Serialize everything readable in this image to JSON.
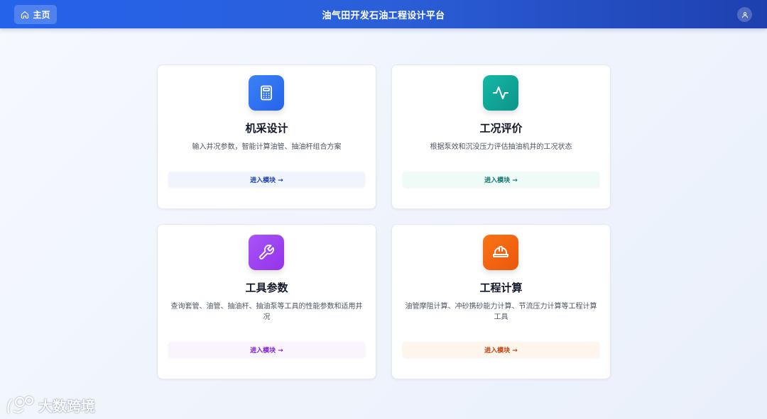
{
  "header": {
    "home_label": "主页",
    "title": "油气田开发石油工程设计平台"
  },
  "cards": [
    {
      "title": "机采设计",
      "desc": "输入井况参数，智能计算油管、抽油杆组合方案",
      "button": "进入模块 →",
      "icon": "calculator-icon",
      "accent": "#3b82f6"
    },
    {
      "title": "工况评价",
      "desc": "根据泵效和沉没压力评估抽油机井的工况状态",
      "button": "进入模块 →",
      "icon": "activity-pulse-icon",
      "accent": "#14b8a6"
    },
    {
      "title": "工具参数",
      "desc": "查询套管、油管、抽油杆、抽油泵等工具的性能参数和适用井况",
      "button": "进入模块 →",
      "icon": "wrench-icon",
      "accent": "#a855f7"
    },
    {
      "title": "工程计算",
      "desc": "油管摩阻计算、冲砂携砂能力计算、节流压力计算等工程计算工具",
      "button": "进入模块 →",
      "icon": "hard-hat-icon",
      "accent": "#f97316"
    }
  ],
  "watermark": {
    "text": "大数跨境"
  }
}
